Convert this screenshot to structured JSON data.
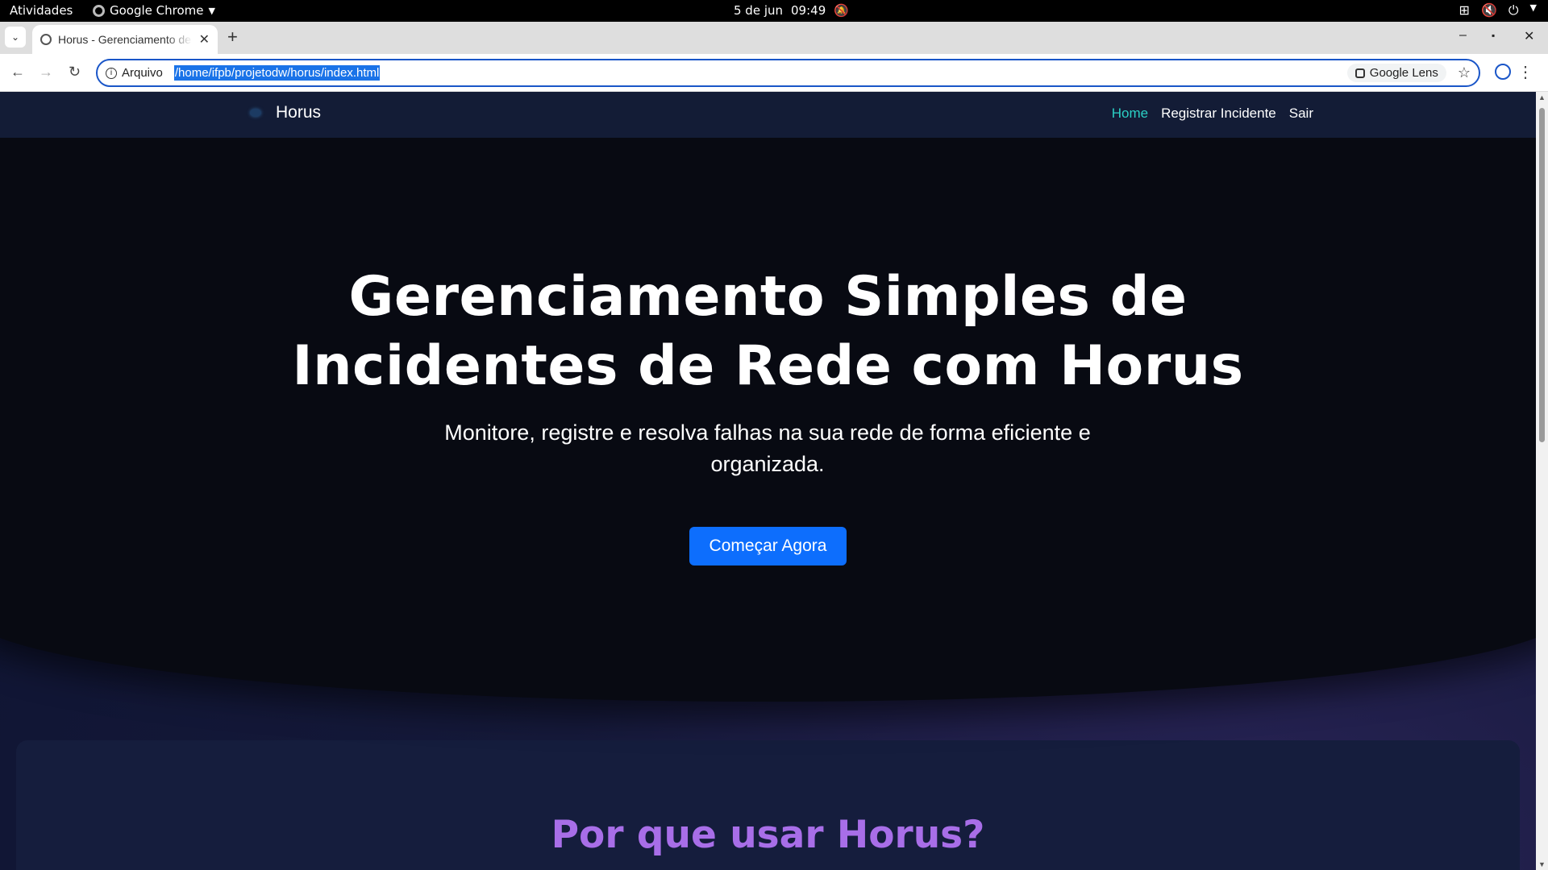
{
  "system_bar": {
    "activities": "Atividades",
    "app_name": "Google Chrome",
    "date": "5 de jun",
    "time": "09:49"
  },
  "browser": {
    "tab_title": "Horus - Gerenciamento de Incidentes",
    "address_scheme": "Arquivo",
    "url": "/home/ifpb/projetodw/horus/index.html",
    "lens_label": "Google Lens"
  },
  "site": {
    "brand": "Horus",
    "nav": [
      {
        "label": "Home",
        "active": true
      },
      {
        "label": "Registrar Incidente",
        "active": false
      },
      {
        "label": "Sair",
        "active": false
      }
    ],
    "hero": {
      "title_line1": "Gerenciamento Simples de",
      "title_line2": "Incidentes de Rede com Horus",
      "subtitle": "Monitore, registre e resolva falhas na sua rede de forma eficiente e organizada.",
      "cta": "Começar Agora"
    },
    "features": {
      "heading": "Por que usar Horus?"
    }
  },
  "colors": {
    "accent": "#0d6efd",
    "nav_active": "#2bd0c5",
    "heading_purple": "#a86ee8"
  }
}
